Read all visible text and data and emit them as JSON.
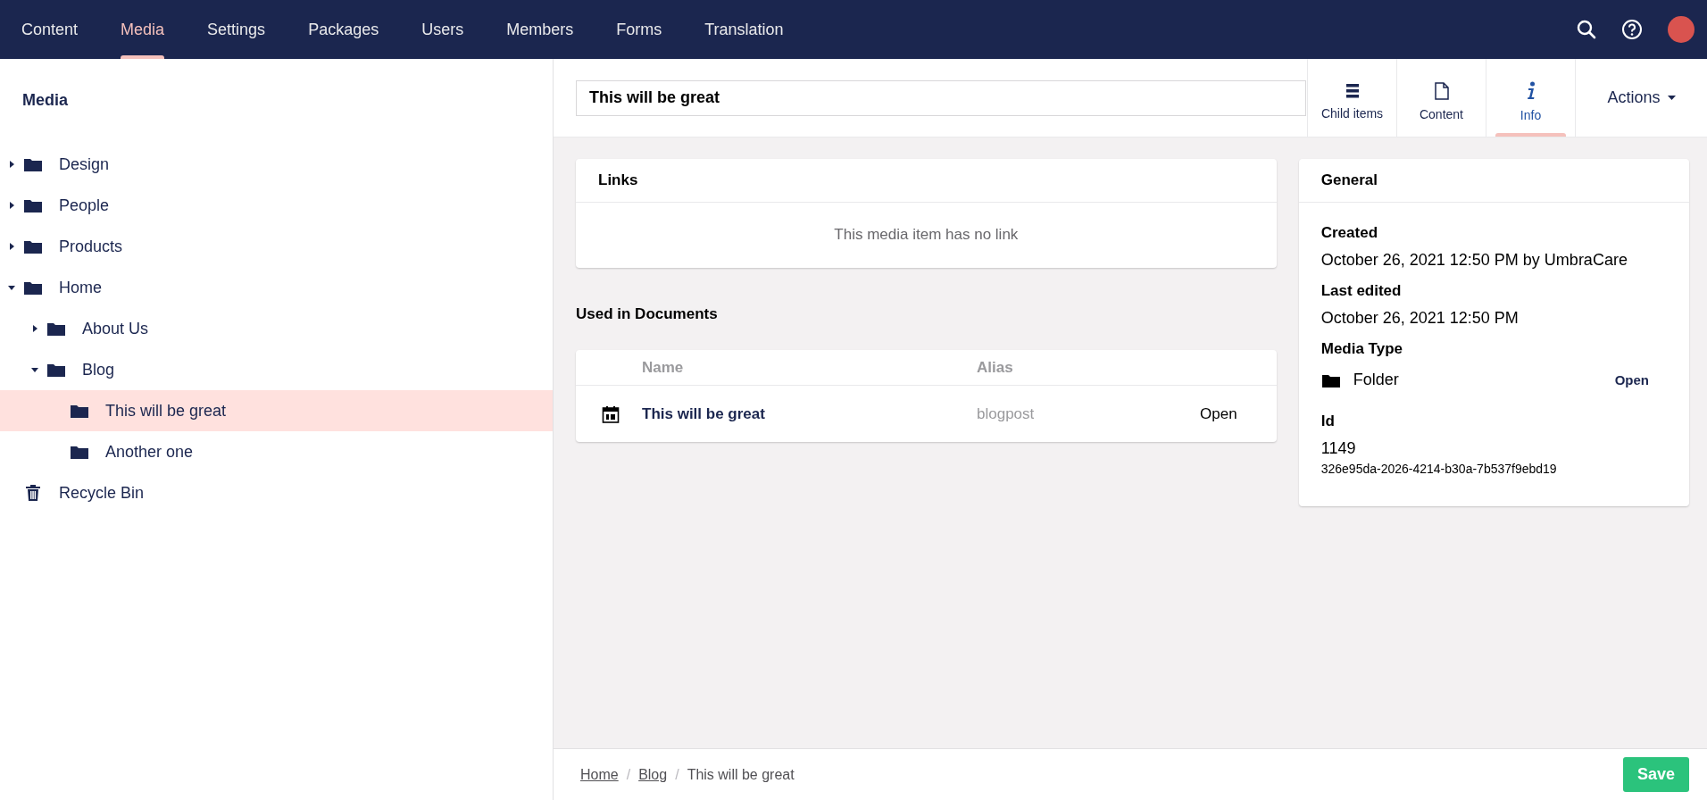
{
  "top_nav": {
    "sections": [
      {
        "label": "Content",
        "selected": false
      },
      {
        "label": "Media",
        "selected": true
      },
      {
        "label": "Settings",
        "selected": false
      },
      {
        "label": "Packages",
        "selected": false
      },
      {
        "label": "Users",
        "selected": false
      },
      {
        "label": "Members",
        "selected": false
      },
      {
        "label": "Forms",
        "selected": false
      },
      {
        "label": "Translation",
        "selected": false
      }
    ]
  },
  "sidebar": {
    "title": "Media",
    "tree": [
      {
        "label": "Design",
        "kind": "folder",
        "has_children": true,
        "expanded": false,
        "selected": false
      },
      {
        "label": "People",
        "kind": "folder",
        "has_children": true,
        "expanded": false,
        "selected": false
      },
      {
        "label": "Products",
        "kind": "folder",
        "has_children": true,
        "expanded": false,
        "selected": false
      },
      {
        "label": "Home",
        "kind": "folder",
        "has_children": true,
        "expanded": true,
        "selected": false,
        "children": [
          {
            "label": "About Us",
            "kind": "folder",
            "has_children": true,
            "expanded": false,
            "selected": false
          },
          {
            "label": "Blog",
            "kind": "folder",
            "has_children": true,
            "expanded": true,
            "selected": false,
            "children": [
              {
                "label": "This will be great",
                "kind": "folder",
                "has_children": false,
                "selected": true
              },
              {
                "label": "Another one",
                "kind": "folder",
                "has_children": false,
                "selected": false
              }
            ]
          }
        ]
      },
      {
        "label": "Recycle Bin",
        "kind": "trash",
        "has_children": false,
        "selected": false
      }
    ]
  },
  "editor": {
    "name_value": "This will be great",
    "apps": [
      {
        "label": "Child items",
        "kind": "list",
        "selected": false
      },
      {
        "label": "Content",
        "kind": "document",
        "selected": false
      },
      {
        "label": "Info",
        "kind": "info",
        "selected": true
      }
    ],
    "actions_label": "Actions"
  },
  "links": {
    "title": "Links",
    "empty_text": "This media item has no link"
  },
  "used_in": {
    "title": "Used in Documents",
    "columns": [
      "Name",
      "Alias"
    ],
    "rows": [
      {
        "name": "This will be great",
        "alias": "blogpost",
        "action": "Open"
      }
    ]
  },
  "general": {
    "title": "General",
    "created_label": "Created",
    "created_value": "October 26, 2021 12:50 PM by UmbraCare",
    "edited_label": "Last edited",
    "edited_value": "October 26, 2021 12:50 PM",
    "type_label": "Media Type",
    "type_value": "Folder",
    "type_action": "Open",
    "id_label": "Id",
    "id_value": "1149",
    "guid": "326e95da-2026-4214-b30a-7b537f9ebd19"
  },
  "breadcrumb": [
    {
      "label": "Home",
      "link": true
    },
    {
      "label": "Blog",
      "link": true
    },
    {
      "label": "This will be great",
      "link": false
    }
  ],
  "breadcrumb_separator": "/",
  "save_label": "Save"
}
